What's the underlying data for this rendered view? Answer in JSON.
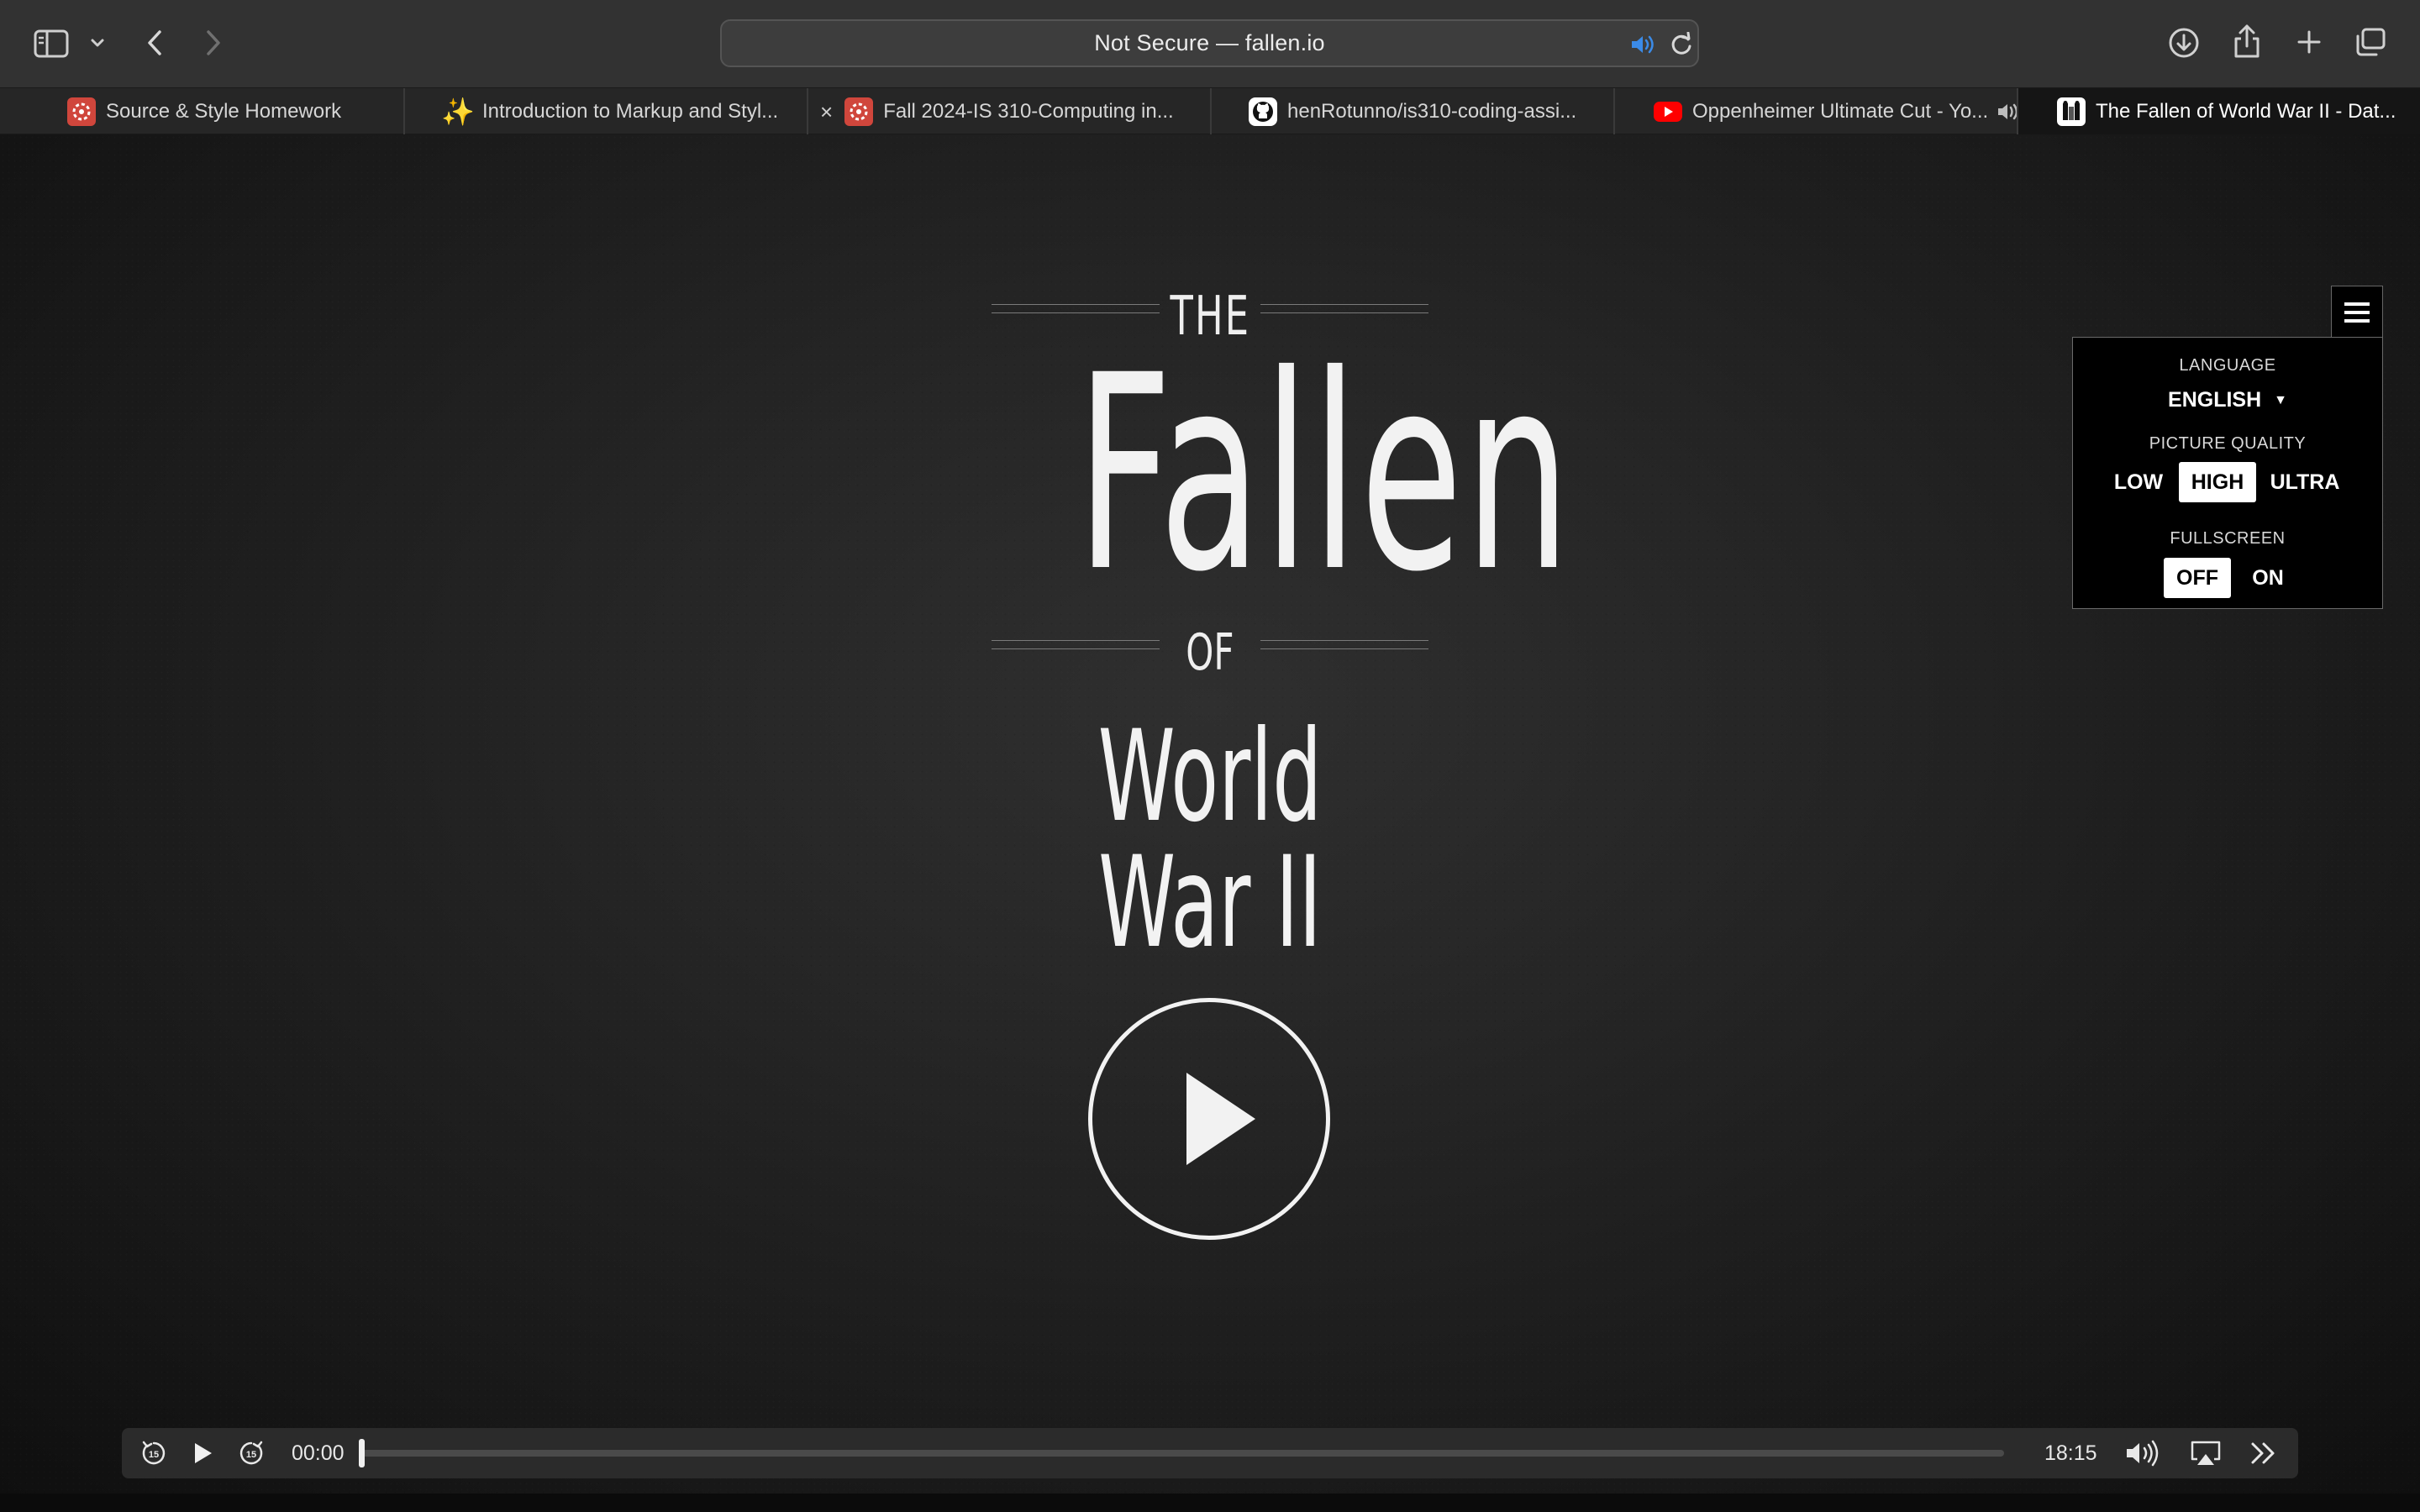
{
  "browser": {
    "url_text": "Not Secure — fallen.io",
    "tabs": [
      {
        "label": "Source & Style Homework",
        "favicon": "red-canvas-icon"
      },
      {
        "label": "Introduction to Markup and Styl...",
        "favicon": "sparkles-icon"
      },
      {
        "label": "Fall 2024-IS 310-Computing in...",
        "favicon": "red-canvas-icon"
      },
      {
        "label": "henRotunno/is310-coding-assi...",
        "favicon": "github-icon"
      },
      {
        "label": "Oppenheimer Ultimate Cut - Yo...",
        "favicon": "youtube-icon"
      },
      {
        "label": "The Fallen of World War II - Dat...",
        "favicon": "fallen-icon",
        "active": true
      }
    ]
  },
  "title": {
    "the": "THE",
    "fallen": "Fallen",
    "of": "OF",
    "world_war": "World War II"
  },
  "settings": {
    "language_label": "LANGUAGE",
    "language_value": "ENGLISH",
    "quality_label": "PICTURE QUALITY",
    "quality_options": [
      "LOW",
      "HIGH",
      "ULTRA"
    ],
    "quality_selected": "HIGH",
    "fullscreen_label": "FULLSCREEN",
    "fullscreen_options": [
      "OFF",
      "ON"
    ],
    "fullscreen_selected": "OFF"
  },
  "player": {
    "current_time": "00:00",
    "duration": "18:15",
    "progress": 0
  },
  "colors": {
    "accent_blue": "#3b8be8",
    "youtube_red": "#ff0000",
    "canvas_red": "#d0463c"
  }
}
